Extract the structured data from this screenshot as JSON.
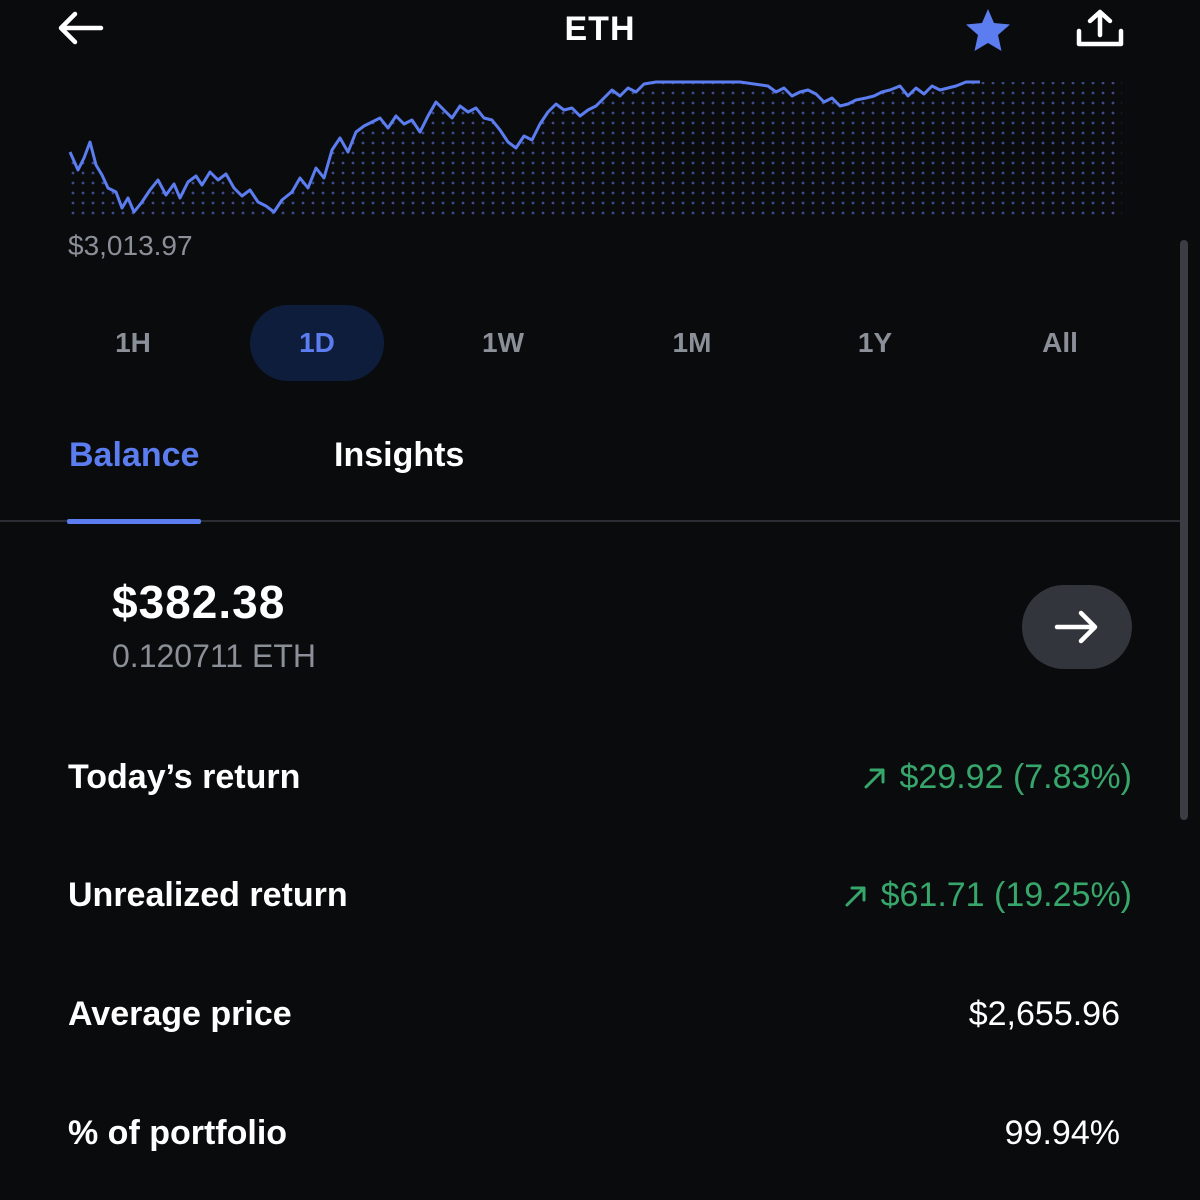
{
  "header": {
    "title": "ETH",
    "icons": {
      "back": "back-arrow-icon",
      "favorite": "star-icon",
      "share": "share-icon"
    }
  },
  "chart": {
    "low_label": "$3,013.97",
    "line_color": "#5b7df0"
  },
  "ranges": {
    "items": [
      {
        "label": "1H",
        "active": false
      },
      {
        "label": "1D",
        "active": true
      },
      {
        "label": "1W",
        "active": false
      },
      {
        "label": "1M",
        "active": false
      },
      {
        "label": "1Y",
        "active": false
      },
      {
        "label": "All",
        "active": false
      }
    ]
  },
  "tabs": {
    "balance": "Balance",
    "insights": "Insights",
    "active": "Balance"
  },
  "balance": {
    "fiat": "$382.38",
    "crypto": "0.120711 ETH"
  },
  "stats": {
    "todays_return": {
      "label": "Today’s return",
      "value": "$29.92 (7.83%)"
    },
    "unrealized_return": {
      "label": "Unrealized return",
      "value": "$61.71 (19.25%)"
    },
    "average_price": {
      "label": "Average price",
      "value": "$2,655.96"
    },
    "portfolio_pct": {
      "label": "% of portfolio",
      "value": "99.94%"
    }
  },
  "colors": {
    "background": "#0a0b0d",
    "accent": "#5b7df0",
    "positive": "#37a66b",
    "muted": "#8a8f98"
  }
}
